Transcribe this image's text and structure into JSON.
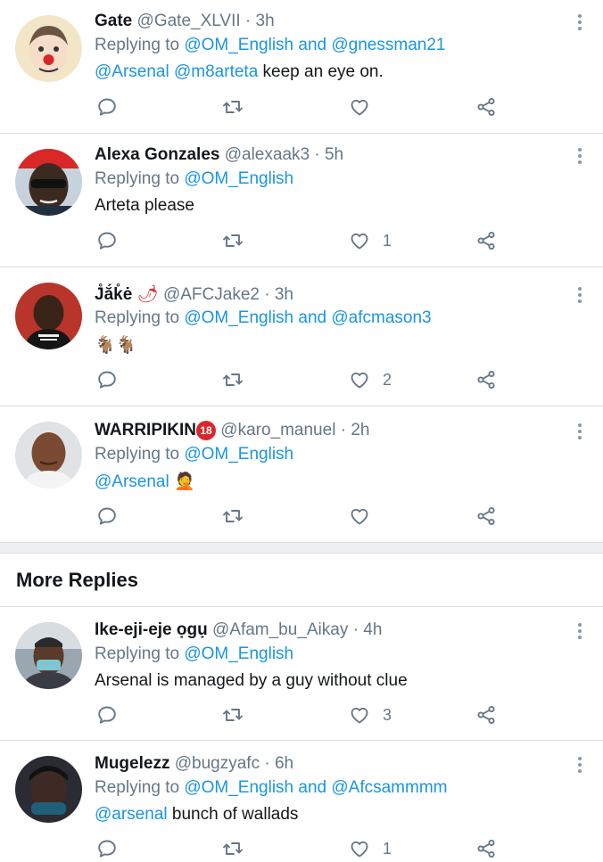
{
  "tweets": [
    {
      "name": "Gate",
      "handle": "@Gate_XLVII",
      "time": "3h",
      "replying_prefix": "Replying to",
      "replying_mentions": "@OM_English and @gnessman21",
      "body_mention": "@Arsenal @m8arteta",
      "body_text": "keep an eye on.",
      "likes": ""
    },
    {
      "name": "Alexa Gonzales",
      "handle": "@alexaak3",
      "time": "5h",
      "replying_prefix": "Replying to",
      "replying_mentions": "@OM_English",
      "body_mention": "",
      "body_text": "Arteta please",
      "likes": "1"
    },
    {
      "name": "J̊ắk̊ė",
      "name_emoji": "🌶",
      "handle": "@AFCJake2",
      "time": "3h",
      "replying_prefix": "Replying to",
      "replying_mentions": "@OM_English and @afcmason3",
      "body_mention": "",
      "body_text": "🐐🐐",
      "likes": "2"
    },
    {
      "name": "WARRIPIKIN",
      "name_badge": "18",
      "handle": "@karo_manuel",
      "time": "2h",
      "replying_prefix": "Replying to",
      "replying_mentions": "@OM_English",
      "body_mention": "@Arsenal",
      "body_text": "🤦",
      "likes": ""
    },
    {
      "name": "Ike-eji-eje ọgụ",
      "handle": "@Afam_bu_Aikay",
      "time": "4h",
      "replying_prefix": "Replying to",
      "replying_mentions": "@OM_English",
      "body_mention": "",
      "body_text": "Arsenal is managed by a guy without clue",
      "likes": "3"
    },
    {
      "name": "Mugelezz",
      "handle": "@bugzyafc",
      "time": "6h",
      "replying_prefix": "Replying to",
      "replying_mentions": "@OM_English and @Afcsammmm",
      "body_mention": "@arsenal",
      "body_text": "bunch of wallads",
      "likes": "1"
    }
  ],
  "section": {
    "more_replies": "More Replies"
  },
  "icons": [
    "reply-icon",
    "retweet-icon",
    "like-icon",
    "share-icon",
    "more-options-icon"
  ],
  "colors": {
    "accent": "#1b95e0",
    "meta": "#657786",
    "divider": "#d9dee2"
  }
}
